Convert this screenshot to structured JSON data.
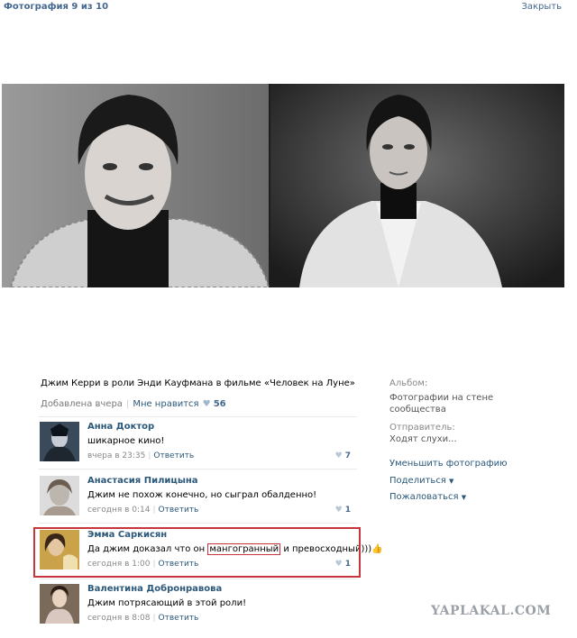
{
  "header": {
    "title": "Фотография 9 из 10",
    "close_label": "Закрыть"
  },
  "photo": {
    "alt_icon": "photo-collage-icon",
    "caption": "Джим Керри в роли Энди Кауфмана в фильме «Человек на Луне»",
    "added": "Добавлена вчера",
    "like_label": "Мне нравится",
    "likes": "56"
  },
  "comments": [
    {
      "name": "Анна Доктор",
      "text": "шикарное кино!",
      "time": "вчера в 23:35",
      "reply": "Ответить",
      "likes": "7"
    },
    {
      "name": "Анастасия Пилицына",
      "text": "Джим не похож конечно, но сыграл обалденно!",
      "time": "сегодня в 0:14",
      "reply": "Ответить",
      "likes": "1"
    },
    {
      "name": "Эмма Саркисян",
      "text_before": "Да джим доказал что он ",
      "text_word": "мангогранный",
      "text_after": " и превосходный)))",
      "time": "сегодня в 1:00",
      "reply": "Ответить",
      "likes": "1"
    },
    {
      "name": "Валентина Добронравова",
      "text": "Джим потрясающий в этой роли!",
      "time": "сегодня в 8:08",
      "reply": "Ответить",
      "likes": ""
    }
  ],
  "sidebar": {
    "album_label": "Альбом:",
    "album_name_line1": "Фотографии на стене",
    "album_name_line2": "сообщества",
    "sender_label": "Отправитель:",
    "sender_name": "Ходят слухи...",
    "shrink": "Уменьшить фотографию",
    "share": "Поделиться",
    "report": "Пожаловаться"
  },
  "watermark": "YAPLAKAL.COM"
}
